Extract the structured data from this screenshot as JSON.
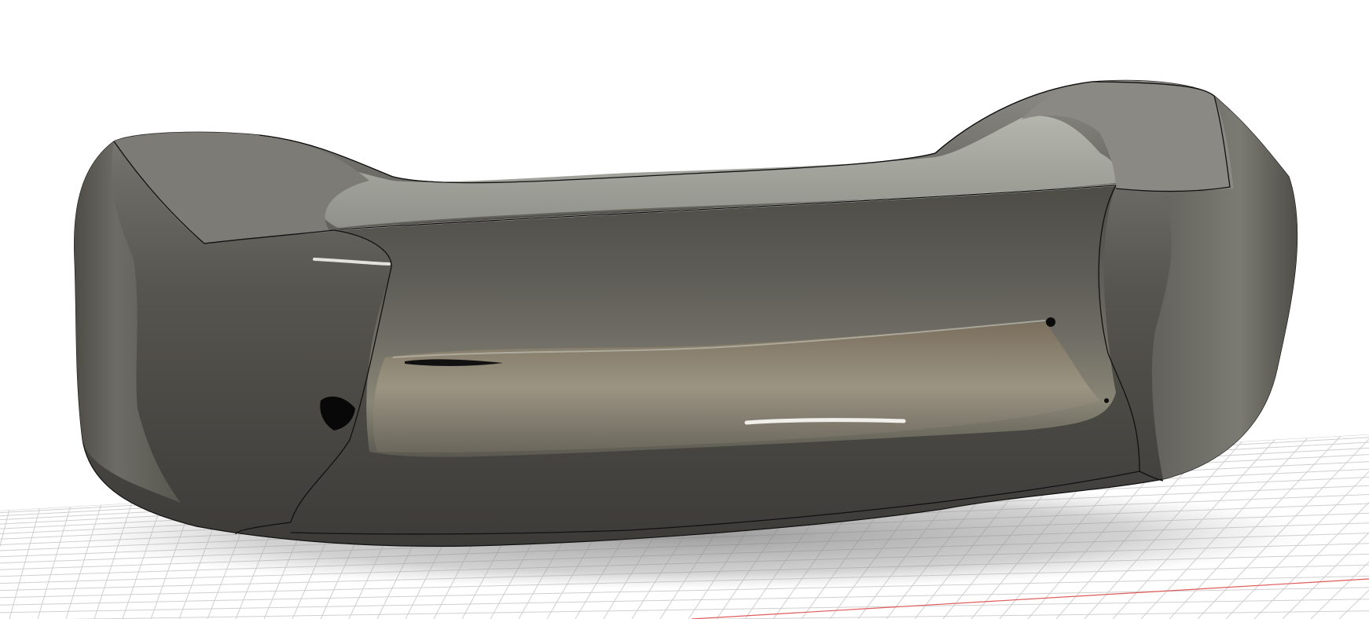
{
  "viewport": {
    "background": "#ffffff",
    "model": {
      "material": "brushed metal",
      "base_color": "#5e5c57",
      "highlight_color": "#f4f3ef",
      "shadow_color": "#111111",
      "edge_line_color": "#111111"
    },
    "ground_grid": {
      "visible": true,
      "line_color": "#cfcfcf",
      "x_axis_color": "#e05a5a"
    },
    "ground_shadow_color": "#8a8a8a"
  }
}
